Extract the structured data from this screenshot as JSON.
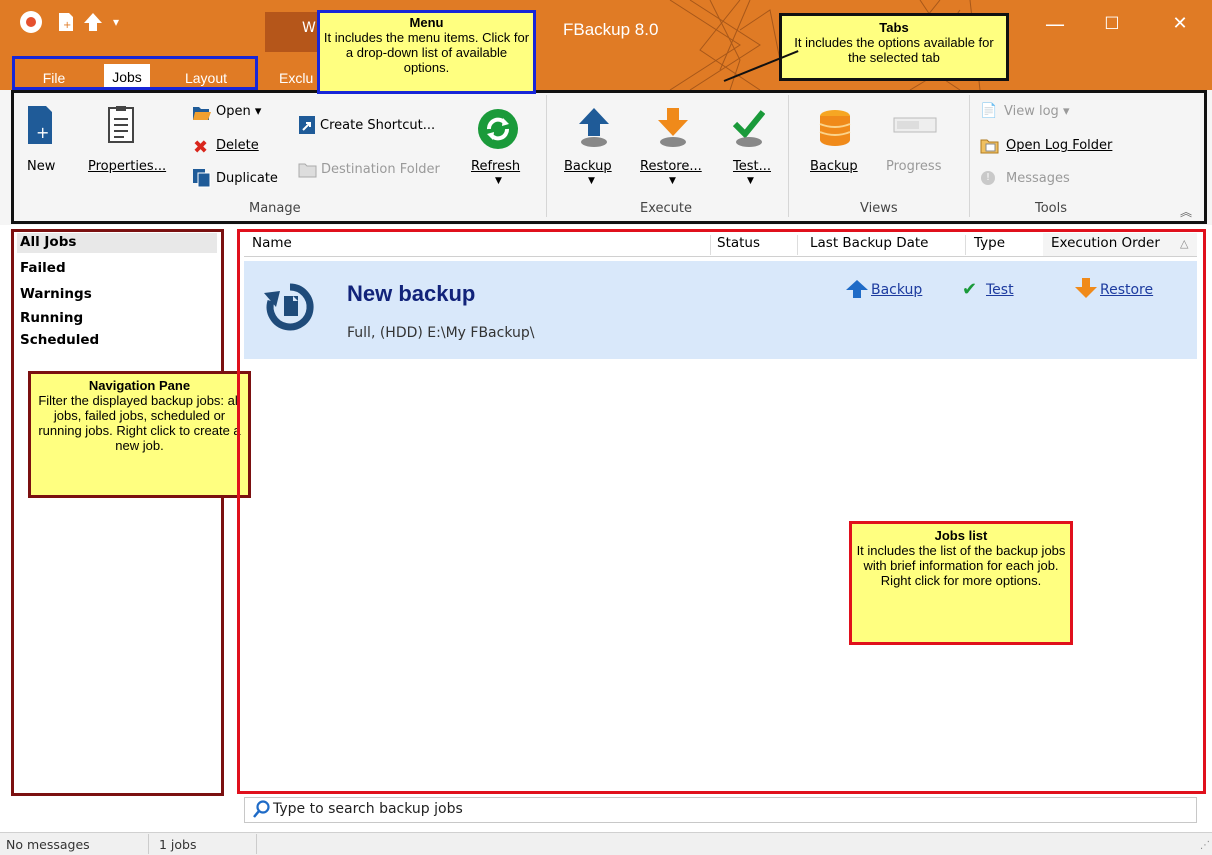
{
  "window": {
    "title": "FBackup 8.0",
    "dark_tab_text": "W"
  },
  "menu_tabs": {
    "file": "File",
    "jobs": "Jobs",
    "layout": "Layout",
    "exclu": "Exclu"
  },
  "window_controls": {
    "minimize": "—",
    "maximize": "☐",
    "close": "✕"
  },
  "ribbon": {
    "manage": {
      "group_label": "Manage",
      "new": "New",
      "properties": "Properties...",
      "open": "Open",
      "delete": "Delete",
      "duplicate": "Duplicate",
      "create_shortcut": "Create Shortcut...",
      "destination_folder": "Destination Folder",
      "refresh": "Refresh"
    },
    "execute": {
      "group_label": "Execute",
      "backup": "Backup",
      "restore": "Restore...",
      "test": "Test..."
    },
    "views": {
      "group_label": "Views",
      "backup": "Backup",
      "progress": "Progress"
    },
    "tools": {
      "group_label": "Tools",
      "view_log": "View log",
      "open_log_folder": "Open Log Folder",
      "messages": "Messages"
    }
  },
  "annotations": {
    "menu": {
      "title": "Menu",
      "text": "It includes the menu items. Click for a drop-down list of available options."
    },
    "tabs": {
      "title": "Tabs",
      "text": "It includes the options available for the selected tab"
    },
    "nav": {
      "title": "Navigation Pane",
      "text": "Filter the displayed backup jobs: all jobs, failed jobs, scheduled or running jobs. Right click to create a new job."
    },
    "jobs": {
      "title": "Jobs list",
      "text": "It includes the list of the backup jobs with brief information for each job. Right click for more options."
    }
  },
  "nav": {
    "items": [
      "All Jobs",
      "Failed",
      "Warnings",
      "Running",
      "Scheduled"
    ]
  },
  "jobs_list": {
    "columns": [
      "Name",
      "Status",
      "Last Backup Date",
      "Type",
      "Execution Order"
    ],
    "sort_indicator": "△",
    "job": {
      "name": "New backup",
      "details": "Full, (HDD) E:\\My FBackup\\",
      "actions": {
        "backup": "Backup",
        "test": "Test",
        "restore": "Restore"
      }
    }
  },
  "search": {
    "placeholder": "Type to search backup jobs"
  },
  "status_bar": {
    "messages": "No messages",
    "count": "1 jobs"
  },
  "colors": {
    "titlebar": "#e07b25",
    "ribbon_bg": "#f5f5f5",
    "job_card": "#d9e8fa",
    "note_bg": "#ffff80",
    "link": "#1d3b9f"
  }
}
